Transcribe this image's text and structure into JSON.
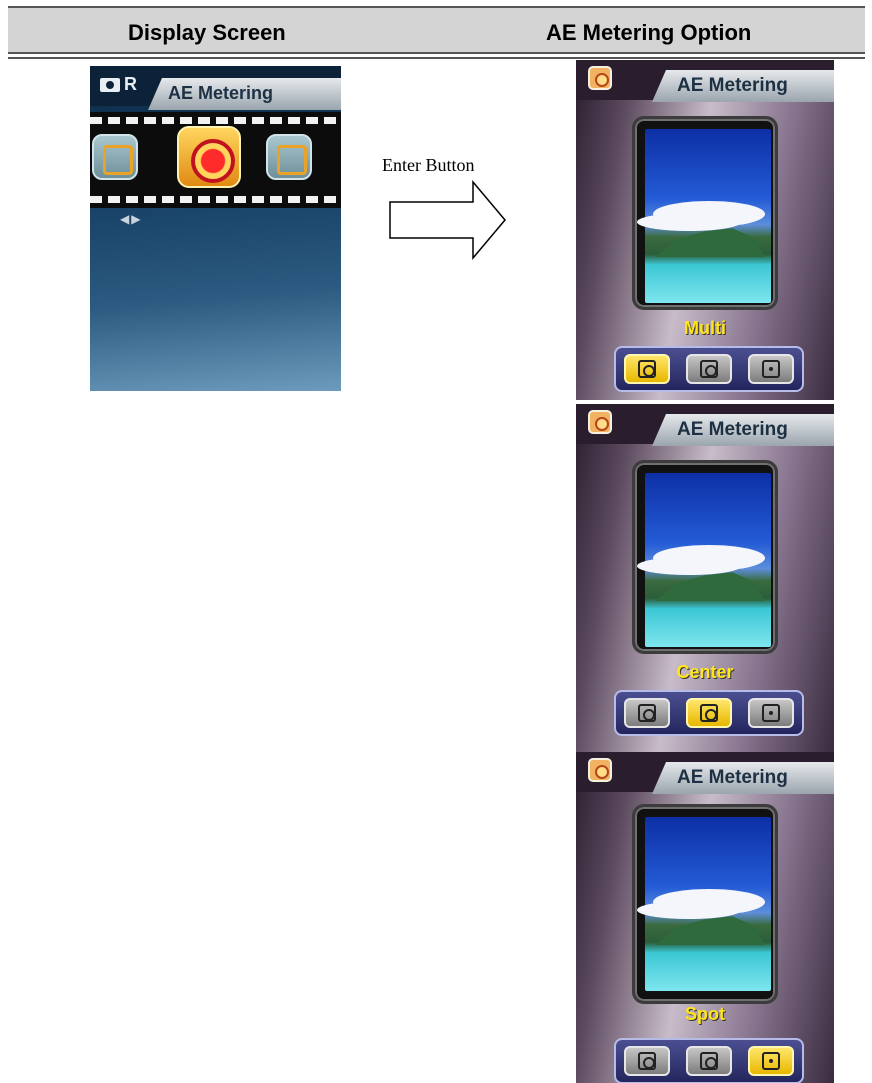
{
  "table": {
    "col_display": "Display Screen",
    "col_option": "AE Metering Option"
  },
  "display_screen": {
    "mode_letter": "R",
    "tab_label": "AE Metering"
  },
  "action": {
    "label": "Enter Button"
  },
  "options": [
    {
      "tab_label": "AE Metering",
      "mode": "Multi",
      "selected_index": 0
    },
    {
      "tab_label": "AE Metering",
      "mode": "Center",
      "selected_index": 1
    },
    {
      "tab_label": "AE Metering",
      "mode": "Spot",
      "selected_index": 2
    }
  ],
  "colors": {
    "header_bg": "#d4d4d4",
    "mode_label": "#ffe51a",
    "selected_option": "#ffe66a"
  },
  "icons": [
    "camera-icon",
    "metering-icon",
    "multi-metering-icon",
    "center-metering-icon",
    "spot-metering-icon",
    "right-arrow-icon"
  ]
}
